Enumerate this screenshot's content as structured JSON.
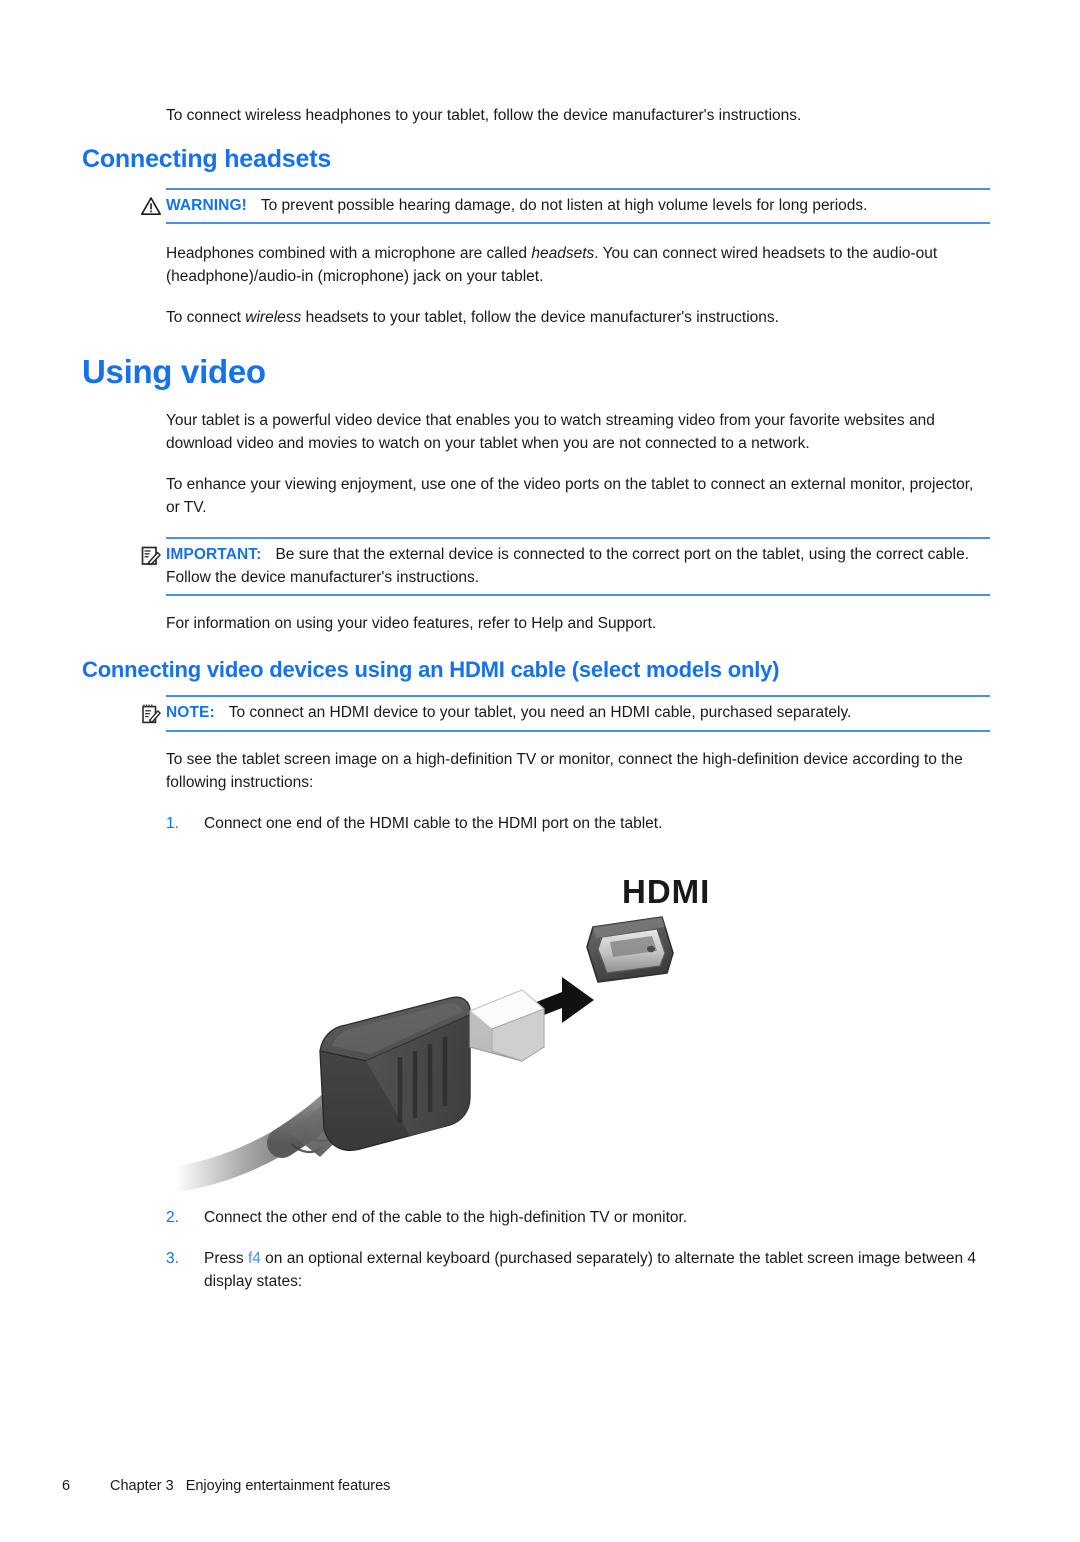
{
  "page": {
    "intro_paragraph": "To connect wireless headphones to your tablet, follow the device manufacturer's instructions.",
    "headings": {
      "connecting_headsets": "Connecting headsets",
      "using_video": "Using video",
      "connecting_video_hdmi": "Connecting video devices using an HDMI cable (select models only)"
    },
    "warning": {
      "icon": "warning-triangle-icon",
      "label": "WARNING!",
      "text": "To prevent possible hearing damage, do not listen at high volume levels for long periods."
    },
    "headsets_paragraph_1_part1": "Headphones combined with a microphone are called ",
    "headsets_paragraph_1_italic": "headsets",
    "headsets_paragraph_1_part2": ". You can connect wired headsets to the audio-out (headphone)/audio-in (microphone) jack on your tablet.",
    "headsets_paragraph_2_part1": "To connect ",
    "headsets_paragraph_2_italic": "wireless",
    "headsets_paragraph_2_part2": " headsets to your tablet, follow the device manufacturer's instructions.",
    "video_paragraph_1": "Your tablet is a powerful video device that enables you to watch streaming video from your favorite websites and download video and movies to watch on your tablet when you are not connected to a network.",
    "video_paragraph_2": "To enhance your viewing enjoyment, use one of the video ports on the tablet to connect an external monitor, projector, or TV.",
    "important": {
      "icon": "note-pencil-icon",
      "label": "IMPORTANT:",
      "text": "Be sure that the external device is connected to the correct port on the tablet, using the correct cable. Follow the device manufacturer's instructions."
    },
    "video_paragraph_3": "For information on using your video features, refer to Help and Support.",
    "note": {
      "icon": "notepad-pencil-icon",
      "label": "NOTE:",
      "text": "To connect an HDMI device to your tablet, you need an HDMI cable, purchased separately."
    },
    "hdmi_intro": "To see the tablet screen image on a high-definition TV or monitor, connect the high-definition device according to the following instructions:",
    "steps": [
      {
        "number": "1.",
        "text": "Connect one end of the HDMI cable to the HDMI port on the tablet."
      },
      {
        "number": "2.",
        "text": "Connect the other end of the cable to the high-definition TV or monitor."
      },
      {
        "number": "3.",
        "text_part1": "Press ",
        "key": "f4",
        "text_part2": " on an optional external keyboard (purchased separately) to alternate the tablet screen image between 4 display states:"
      }
    ],
    "figure": {
      "name": "hdmi-cable-connection-illustration",
      "port_label": "HDMI",
      "alt": "HDMI cable connector being inserted into an HDMI port"
    },
    "footer": {
      "page_number": "6",
      "chapter": "Chapter 3",
      "chapter_title": "Enjoying entertainment features"
    },
    "colors": {
      "heading_blue": "#1672ec",
      "rule_blue": "#4a90e8",
      "key_blue": "#4a90e8",
      "body_text": "#1a1a1a"
    }
  }
}
